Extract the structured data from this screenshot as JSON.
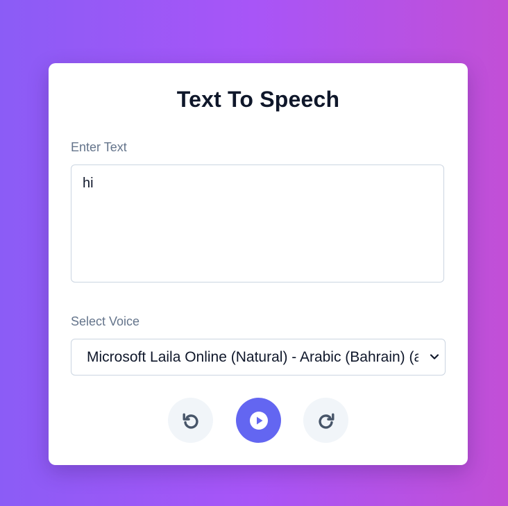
{
  "app": {
    "title": "Text To Speech"
  },
  "text_input": {
    "label": "Enter Text",
    "value": "hi"
  },
  "voice_select": {
    "label": "Select Voice",
    "selected": "Microsoft Laila Online (Natural) - Arabic (Bahrain) (ar-BH)"
  },
  "controls": {
    "rewind_icon": "rotate-ccw-icon",
    "play_icon": "play-circle-icon",
    "forward_icon": "rotate-cw-icon"
  },
  "colors": {
    "gradient_start": "#8b5cf6",
    "gradient_end": "#c24fd6",
    "accent": "#6366f1",
    "secondary_button": "#f1f5f9",
    "icon_dark": "#475569"
  }
}
